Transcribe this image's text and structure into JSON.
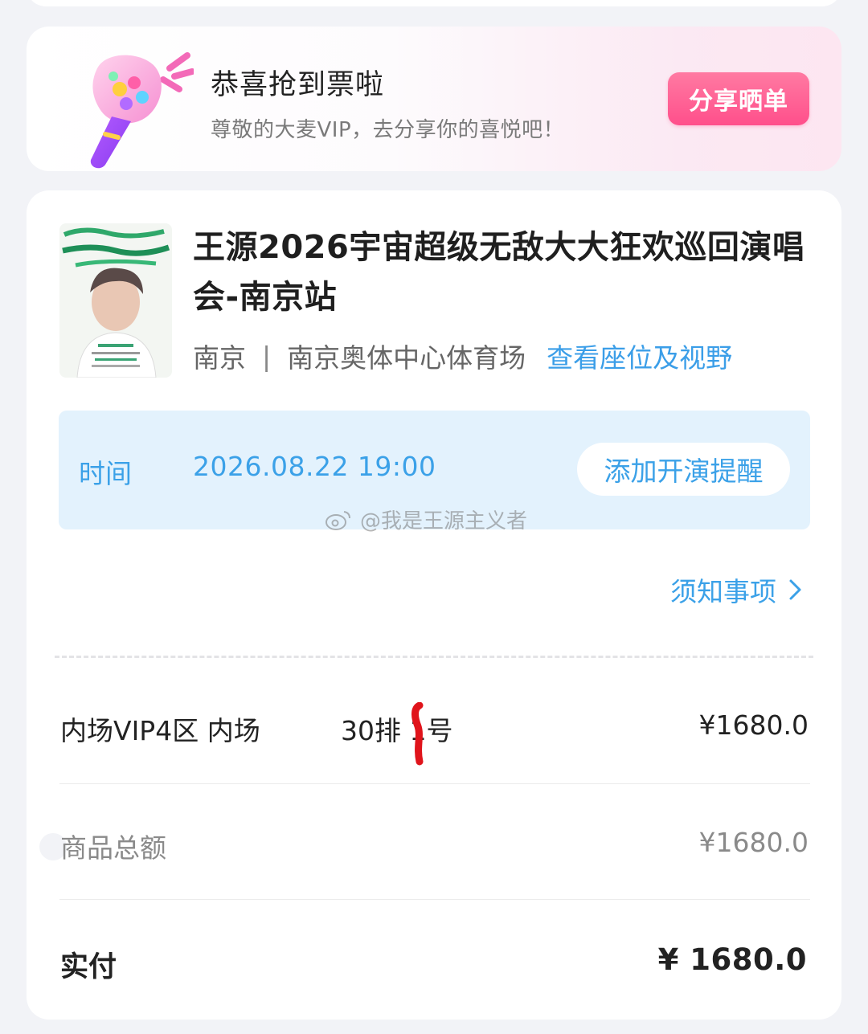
{
  "banner": {
    "title": "恭喜抢到票啦",
    "subtitle": "尊敬的大麦VIP，去分享你的喜悦吧！",
    "share_button": "分享晒单"
  },
  "event": {
    "title": "王源2026宇宙超级无敌大大狂欢巡回演唱会-南京站",
    "city": "南京",
    "separator": "|",
    "venue": "南京奥体中心体育场",
    "seat_view_link": "查看座位及视野"
  },
  "schedule": {
    "label": "时间",
    "datetime": "2026.08.22 19:00",
    "remind_button": "添加开演提醒"
  },
  "watermark": "@我是王源主义者",
  "notice_link": "须知事项",
  "ticket": {
    "zone": "内场VIP4区 内场",
    "seat": "30排 1号",
    "price": "¥1680.0"
  },
  "summary": {
    "goods_total_label": "商品总额",
    "goods_total_value": "¥1680.0",
    "paid_label": "实付",
    "paid_value": "¥ 1680.0"
  },
  "colors": {
    "accent_blue": "#3ba1e8",
    "share_pink": "#ff4f8b",
    "time_box_bg": "#e3f2fd"
  }
}
